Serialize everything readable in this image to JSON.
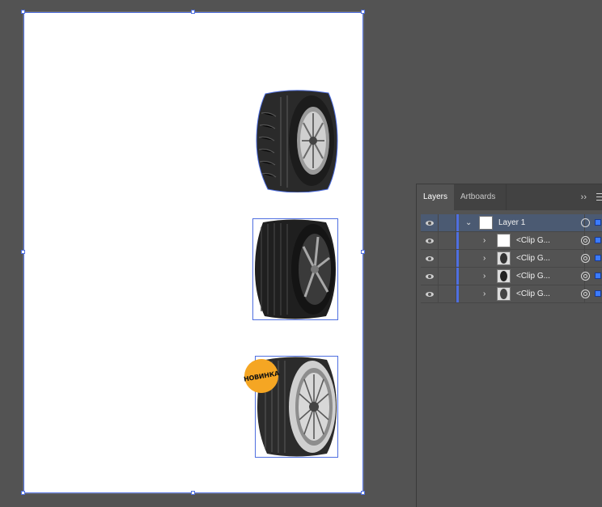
{
  "panel": {
    "tabs": [
      "Layers",
      "Artboards"
    ],
    "overflow_icon": "double-chevron-icon",
    "menu_icon": "panel-menu-icon"
  },
  "layers": [
    {
      "name": "Layer 1",
      "expanded": true,
      "selected": true
    },
    {
      "name": "<Clip G...",
      "expanded": false
    },
    {
      "name": "<Clip G...",
      "expanded": false
    },
    {
      "name": "<Clip G...",
      "expanded": false
    },
    {
      "name": "<Clip G...",
      "expanded": false
    }
  ],
  "badge": {
    "text": "НОВИНКА"
  },
  "colors": {
    "selection": "#4f6fe0",
    "badge": "#f5a623",
    "panel_bg": "#535353",
    "layer_highlight": "#4b5a72"
  }
}
